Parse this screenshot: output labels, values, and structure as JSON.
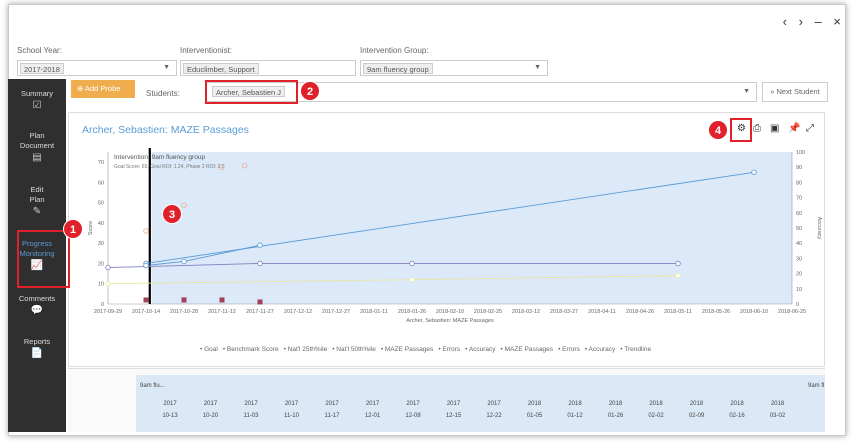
{
  "window_controls": "‹ › ‒ ×",
  "filters": {
    "school_year": {
      "label": "School Year:",
      "value": "2017-2018"
    },
    "interventionist": {
      "label": "Interventionist:",
      "value": "Educlimber, Support"
    },
    "intervention_group": {
      "label": "Intervention Group:",
      "value": "9am fluency group"
    }
  },
  "sidebar": {
    "items": [
      {
        "label": "Summary",
        "icon": "check-square-icon"
      },
      {
        "label": "Plan Document",
        "icon": "document-icon"
      },
      {
        "label": "Edit Plan",
        "icon": "edit-icon"
      },
      {
        "label": "Progress Monitoring",
        "icon": "line-chart-icon",
        "active": true
      },
      {
        "label": "Comments",
        "icon": "comment-icon"
      },
      {
        "label": "Reports",
        "icon": "report-icon"
      }
    ]
  },
  "toolbar": {
    "add_probe_label": "Add Probe",
    "students_label": "Students:",
    "student_value": "Archer, Sebastien J",
    "next_student_label": "Next Student"
  },
  "chart_panel": {
    "title": "Archer, Sebastien: MAZE Passages",
    "intervention_note": "Intervention: 9am fluency group",
    "goal_note": "Goal Score: 65, Goal ROI: 1.24, Phase 2 ROI: 2.5"
  },
  "annotations": {
    "one": "1",
    "two": "2",
    "three": "3",
    "four": "4"
  },
  "chart_data": {
    "type": "line",
    "xlabel": "Archer, Sebastien: MAZE Passages",
    "ylabel": "Score",
    "y2label": "Accuracy",
    "ylim": [
      0,
      75
    ],
    "y2lim": [
      0,
      100
    ],
    "y_ticks": [
      "0",
      "10",
      "20",
      "30",
      "40",
      "50",
      "60",
      "70"
    ],
    "y2_ticks": [
      "0",
      "10",
      "20",
      "30",
      "40",
      "50",
      "60",
      "70",
      "80",
      "90",
      "100"
    ],
    "x_ticks": [
      "2017-09-29",
      "2017-10-14",
      "2017-10-28",
      "2017-11-12",
      "2017-11-27",
      "2017-12-12",
      "2017-12-27",
      "2018-01-11",
      "2018-01-26",
      "2018-02-10",
      "2018-02-25",
      "2018-03-12",
      "2018-03-27",
      "2018-04-11",
      "2018-04-26",
      "2018-05-11",
      "2018-05-26",
      "2018-06-10",
      "2018-06-25"
    ],
    "series": [
      {
        "name": "Goal",
        "color": "#5b9bd5",
        "points": [
          [
            1,
            20
          ],
          [
            17,
            65
          ]
        ]
      },
      {
        "name": "Benchmark Score",
        "color": "#8080c0",
        "points": [
          [
            0,
            18
          ],
          [
            4,
            20
          ],
          [
            8,
            20
          ],
          [
            15,
            20
          ]
        ]
      },
      {
        "name": "Nat'l 25th%ile",
        "color": "#e8e8a0",
        "points": [
          [
            0,
            10
          ],
          [
            8,
            12
          ],
          [
            15,
            14
          ]
        ]
      },
      {
        "name": "MAZE Passages",
        "color": "#5b9bd5",
        "points": [
          [
            1,
            19
          ],
          [
            2,
            21
          ],
          [
            4,
            29
          ]
        ]
      },
      {
        "name": "Errors",
        "color": "#a0405a",
        "points": [
          [
            1,
            2
          ],
          [
            2,
            2
          ],
          [
            3,
            2
          ],
          [
            4,
            1
          ]
        ]
      },
      {
        "name": "Accuracy",
        "color": "#f0ad80",
        "points": [
          [
            1,
            48
          ],
          [
            2,
            65
          ],
          [
            3,
            90
          ],
          [
            3.6,
            91
          ]
        ]
      }
    ],
    "legend": [
      "Goal",
      "Benchmark Score",
      "Nat'l 25th%ile",
      "Nat'l 50th%ile",
      "MAZE Passages",
      "Errors",
      "Accuracy",
      "MAZE Passages",
      "Errors",
      "Accuracy",
      "Trendline"
    ],
    "legend_placement": "bottom"
  },
  "table": {
    "group_label": "9am flu...",
    "group_label_right": "9am fl",
    "dates": [
      [
        "2017",
        "10-13"
      ],
      [
        "2017",
        "10-20"
      ],
      [
        "2017",
        "11-03"
      ],
      [
        "2017",
        "11-10"
      ],
      [
        "2017",
        "11-17"
      ],
      [
        "2017",
        "12-01"
      ],
      [
        "2017",
        "12-08"
      ],
      [
        "2017",
        "12-15"
      ],
      [
        "2017",
        "12-22"
      ],
      [
        "2018",
        "01-05"
      ],
      [
        "2018",
        "01-12"
      ],
      [
        "2018",
        "01-26"
      ],
      [
        "2018",
        "02-02"
      ],
      [
        "2018",
        "02-09"
      ],
      [
        "2018",
        "02-16"
      ],
      [
        "2018",
        "03-02"
      ]
    ]
  },
  "colors": {
    "accent": "#5b9bd5",
    "annotation": "#e0202a",
    "add_probe": "#f0ad4e",
    "sidebar": "#2f2f2f"
  }
}
